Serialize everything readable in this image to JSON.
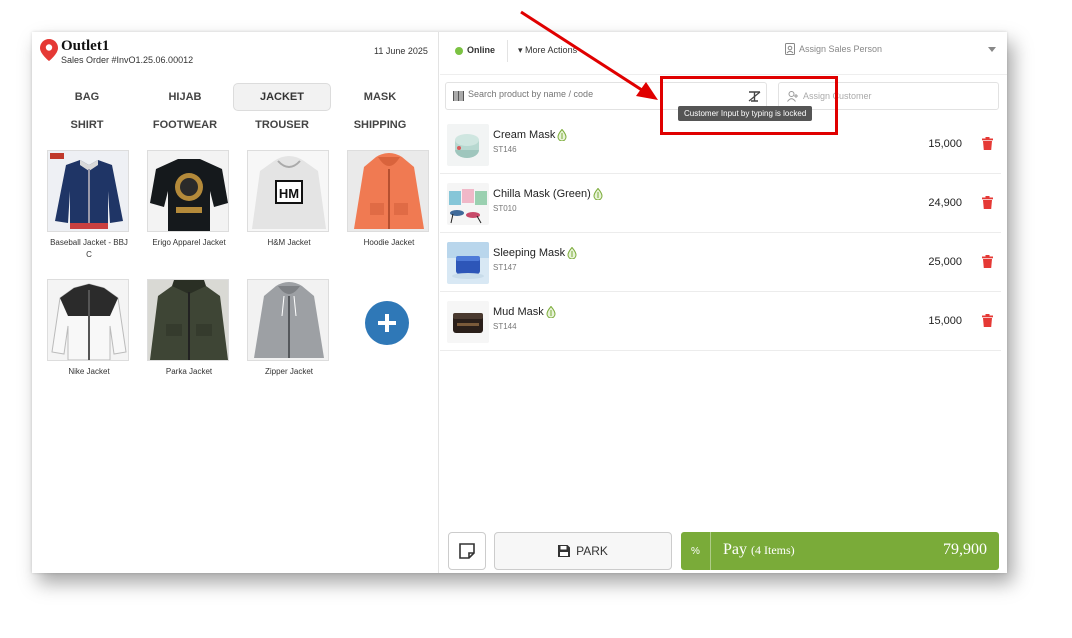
{
  "header": {
    "outlet_name": "Outlet1",
    "order_number": "Sales Order #InvO1.25.06.00012",
    "date": "11 June 2025"
  },
  "categories": [
    "BAG",
    "HIJAB",
    "JACKET",
    "MASK",
    "SHIRT",
    "FOOTWEAR",
    "TROUSER",
    "SHIPPING"
  ],
  "active_category": "JACKET",
  "products": [
    {
      "name": "Baseball Jacket - BBJ C"
    },
    {
      "name": "Erigo Apparel Jacket"
    },
    {
      "name": "H&M Jacket"
    },
    {
      "name": "Hoodie Jacket"
    },
    {
      "name": "Nike Jacket"
    },
    {
      "name": "Parka Jacket"
    },
    {
      "name": "Zipper Jacket"
    }
  ],
  "toolbar": {
    "status": "Online",
    "more_actions": "More Actions",
    "assign_sales_person": "Assign Sales Person"
  },
  "search": {
    "placeholder": "Search product by name / code",
    "assign_customer": "Assign Customer",
    "tooltip": "Customer Input by typing is locked"
  },
  "cart": [
    {
      "name": "Cream Mask",
      "sku": "ST146",
      "price": "15,000"
    },
    {
      "name": "Chilla Mask (Green)",
      "sku": "ST010",
      "price": "24,900"
    },
    {
      "name": "Sleeping Mask",
      "sku": "ST147",
      "price": "25,000"
    },
    {
      "name": "Mud Mask",
      "sku": "ST144",
      "price": "15,000"
    }
  ],
  "footer": {
    "park_label": "PARK",
    "discount_symbol": "%",
    "pay_label": "Pay",
    "pay_items": "(4 Items)",
    "total": "79,900"
  },
  "colors": {
    "accent_green": "#7aab39",
    "online_green": "#7bc242",
    "add_button_blue": "#2f78b7",
    "delete_red": "#e53935",
    "annotation_red": "#e00000"
  }
}
